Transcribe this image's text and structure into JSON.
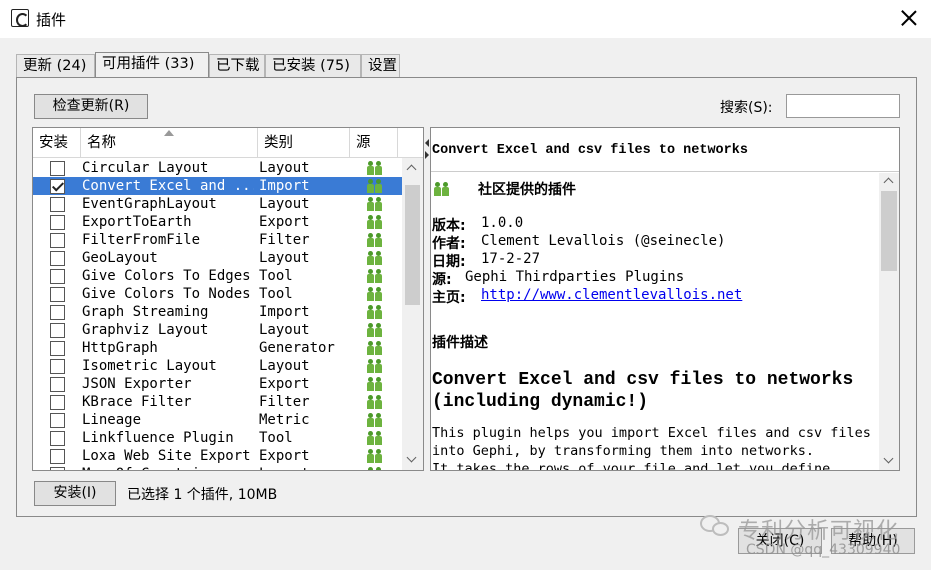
{
  "window": {
    "title": "插件"
  },
  "tabs": [
    {
      "label": "更新 (24)",
      "active": false
    },
    {
      "label": "可用插件 (33)",
      "active": true
    },
    {
      "label": "已下载",
      "active": false
    },
    {
      "label": "已安装 (75)",
      "active": false
    },
    {
      "label": "设置",
      "active": false
    }
  ],
  "toolbar": {
    "refresh_label": "检查更新(R)",
    "search_label": "搜索(S):",
    "search_value": ""
  },
  "table": {
    "columns": [
      "安装",
      "名称",
      "类别",
      "源"
    ],
    "rows": [
      {
        "name": "Circular Layout",
        "category": "Layout",
        "checked": false,
        "selected": false
      },
      {
        "name": "Convert Excel and ...",
        "category": "Import",
        "checked": true,
        "selected": true
      },
      {
        "name": "EventGraphLayout",
        "category": "Layout",
        "checked": false,
        "selected": false
      },
      {
        "name": "ExportToEarth",
        "category": "Export",
        "checked": false,
        "selected": false
      },
      {
        "name": "FilterFromFile",
        "category": "Filter",
        "checked": false,
        "selected": false
      },
      {
        "name": "GeoLayout",
        "category": "Layout",
        "checked": false,
        "selected": false
      },
      {
        "name": "Give Colors To Edges",
        "category": "Tool",
        "checked": false,
        "selected": false
      },
      {
        "name": "Give Colors To Nodes",
        "category": "Tool",
        "checked": false,
        "selected": false
      },
      {
        "name": "Graph Streaming",
        "category": "Import",
        "checked": false,
        "selected": false
      },
      {
        "name": "Graphviz Layout",
        "category": "Layout",
        "checked": false,
        "selected": false
      },
      {
        "name": "HttpGraph",
        "category": "Generator",
        "checked": false,
        "selected": false
      },
      {
        "name": "Isometric Layout",
        "category": "Layout",
        "checked": false,
        "selected": false
      },
      {
        "name": "JSON Exporter",
        "category": "Export",
        "checked": false,
        "selected": false
      },
      {
        "name": "KBrace Filter",
        "category": "Filter",
        "checked": false,
        "selected": false
      },
      {
        "name": "Lineage",
        "category": "Metric",
        "checked": false,
        "selected": false
      },
      {
        "name": "Linkfluence Plugin",
        "category": "Tool",
        "checked": false,
        "selected": false
      },
      {
        "name": "Loxa Web Site Export",
        "category": "Export",
        "checked": false,
        "selected": false
      },
      {
        "name": "Map Of Countries",
        "category": "Layout",
        "checked": false,
        "selected": false
      }
    ]
  },
  "detail": {
    "header": "Convert Excel and csv files to networks",
    "community": "社区提供的插件",
    "version_label": "版本:",
    "version": "1.0.0",
    "author_label": "作者:",
    "author": "Clement Levallois (@seinecle)",
    "date_label": "日期:",
    "date": "17-2-27",
    "source_label": "源:",
    "source": "Gephi Thirdparties Plugins",
    "homepage_label": "主页:",
    "homepage": "http://www.clementlevallois.net",
    "desc_label": "插件描述",
    "big_title_1": "Convert Excel and csv files to networks",
    "big_title_2": "(including dynamic!)",
    "desc_1": "This plugin helps you import Excel files and csv files",
    "desc_2": "into Gephi, by transforming them into networks.",
    "desc_3": "It takes the rows of your file and let you define"
  },
  "footer": {
    "install_label": "安装(I)",
    "status": "已选择 1 个插件, 10MB",
    "close_label": "关闭(C)",
    "help_label": "帮助(H)"
  },
  "watermark": {
    "title": "专利分析可视化",
    "csdn": "CSDN @qq_43309940"
  },
  "colors": {
    "selection": "#3a7bd5",
    "link": "#0000ee",
    "source_icon": "#6db33f"
  }
}
